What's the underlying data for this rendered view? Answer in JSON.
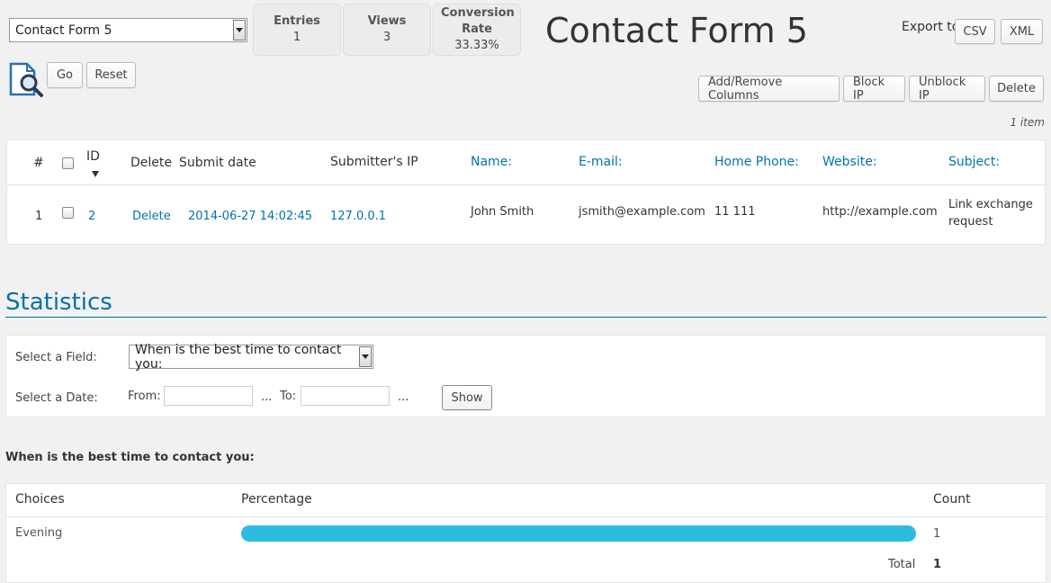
{
  "form_select": {
    "value": "Contact Form 5"
  },
  "stats": [
    {
      "label": "Entries",
      "value": "1"
    },
    {
      "label": "Views",
      "value": "3"
    },
    {
      "label": "Conversion Rate",
      "value": "33.33%"
    }
  ],
  "page_title": "Contact Form 5",
  "export": {
    "label": "Export to",
    "csv": "CSV",
    "xml": "XML"
  },
  "toolbar": {
    "go": "Go",
    "reset": "Reset",
    "add_remove_columns": "Add/Remove Columns",
    "block_ip": "Block IP",
    "unblock_ip": "Unblock IP",
    "delete": "Delete"
  },
  "item_count": "1 item",
  "table": {
    "headers": {
      "num": "#",
      "id": "ID",
      "delete": "Delete",
      "submit_date": "Submit date",
      "submitter_ip": "Submitter's IP",
      "name": "Name:",
      "email": "E-mail:",
      "home_phone": "Home Phone:",
      "website": "Website:",
      "subject": "Subject:"
    },
    "rows": [
      {
        "num": "1",
        "id": "2",
        "delete": "Delete",
        "submit_date": "2014-06-27 14:02:45",
        "submitter_ip": "127.0.0.1",
        "name": "John Smith",
        "email": "jsmith@example.com",
        "home_phone": "11 111",
        "website": "http://example.com",
        "subject": "Link exchange request"
      }
    ]
  },
  "statistics": {
    "title": "Statistics",
    "select_field_label": "Select a Field:",
    "select_field_value": "When is the best time to contact you:",
    "select_date_label": "Select a Date:",
    "from_label": "From:",
    "to_label": "To:",
    "ellipsis": "...",
    "show_button": "Show",
    "question": "When is the best time to contact you:",
    "results": {
      "headers": {
        "choices": "Choices",
        "percentage": "Percentage",
        "count": "Count"
      },
      "rows": [
        {
          "choice": "Evening",
          "percent": 100,
          "count": "1"
        }
      ],
      "total_label": "Total",
      "total_value": "1"
    }
  },
  "colors": {
    "accent": "#0073aa",
    "bar": "#2ebbe0"
  },
  "icons": {
    "search_doc": "document-search-icon",
    "sort": "sort-down-icon"
  }
}
